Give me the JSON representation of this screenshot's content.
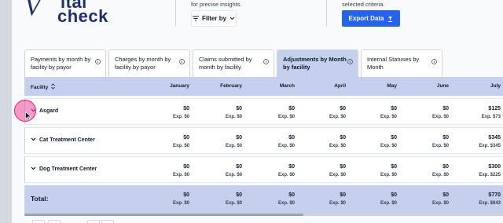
{
  "header": {
    "logo_letter": "V",
    "logo_word_1": "ital",
    "logo_word_2": "check",
    "filter_hint": "for precise insights.",
    "filter_label": "Filter by",
    "export_hint": "selected criteria.",
    "export_label": "Export Data"
  },
  "tabs": [
    {
      "label": "Payments by month by facility by payor",
      "active": false
    },
    {
      "label": "Charges by month by facility by payor",
      "active": false
    },
    {
      "label": "Claims submitted by month by facility",
      "active": false
    },
    {
      "label": "Adjustments by Month by facility",
      "active": true
    },
    {
      "label": "Internal Statuses by Month",
      "active": false
    }
  ],
  "table": {
    "facility_header": "Facility",
    "months": [
      "January",
      "February",
      "March",
      "April",
      "May",
      "June",
      "July"
    ],
    "rows": [
      {
        "name": "Asgard",
        "values": [
          "$0",
          "$0",
          "$0",
          "$0",
          "$0",
          "$0",
          "$125"
        ],
        "exp": [
          "Exp. $0",
          "Exp. $0",
          "Exp. $0",
          "Exp. $0",
          "Exp. $0",
          "Exp. $0",
          "Exp. $73"
        ]
      },
      {
        "name": "Cat Treatment Center",
        "values": [
          "$0",
          "$0",
          "$0",
          "$0",
          "$0",
          "$0",
          "$345"
        ],
        "exp": [
          "Exp. $0",
          "Exp. $0",
          "Exp. $0",
          "Exp. $0",
          "Exp. $0",
          "Exp. $0",
          "Exp. $345"
        ]
      },
      {
        "name": "Dog Treatment Center",
        "values": [
          "$0",
          "$0",
          "$0",
          "$0",
          "$0",
          "$0",
          "$300"
        ],
        "exp": [
          "Exp. $0",
          "Exp. $0",
          "Exp. $0",
          "Exp. $0",
          "Exp. $0",
          "Exp. $0",
          "Exp. $225"
        ]
      }
    ],
    "total": {
      "label": "Total:",
      "values": [
        "$0",
        "$0",
        "$0",
        "$0",
        "$0",
        "$0",
        "$770"
      ],
      "exp": [
        "Exp. $0",
        "Exp. $0",
        "Exp. $0",
        "Exp. $0",
        "Exp. $0",
        "Exp. $0",
        "Exp. $643"
      ]
    }
  },
  "colors": {
    "accent": "#2563eb",
    "header_bg": "#c5d0ee",
    "brand": "#1e2f6b",
    "highlight": "#ec4899"
  }
}
